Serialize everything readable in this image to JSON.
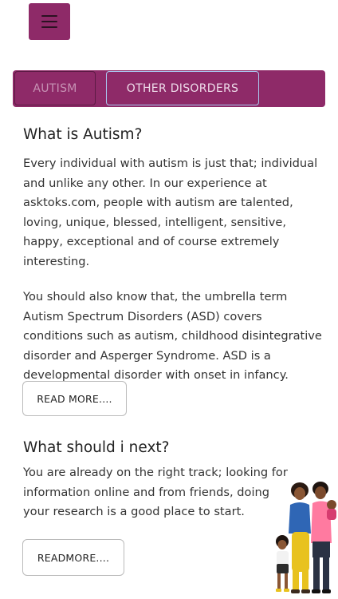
{
  "header": {
    "menu_icon": "hamburger-icon"
  },
  "tabs": [
    {
      "label": "AUTISM"
    },
    {
      "label": "OTHER DISORDERS"
    }
  ],
  "what_is": {
    "heading": "What is Autism?",
    "paragraphs": [
      "Every individual with autism is just that; individual and unlike any other. In our experience at asktoks.com, people with autism are talented, loving, unique, blessed, intelligent, sensitive, happy, exceptional and of course extremely interesting.",
      "You should also know that, the umbrella term Autism Spectrum Disorders (ASD) covers conditions such as autism, childhood disintegrative disorder and Asperger Syndrome. ASD is a developmental disorder with onset in infancy."
    ],
    "button_label": "READ MORE...."
  },
  "what_next": {
    "heading": "What should i next?",
    "paragraph": "You are already on the right track; looking for information online and from friends, doing your research is a good place to start.",
    "button_label": "READMORE...."
  },
  "colors": {
    "brand": "#8e2a68",
    "tab_active_border": "#a9c7f0"
  }
}
